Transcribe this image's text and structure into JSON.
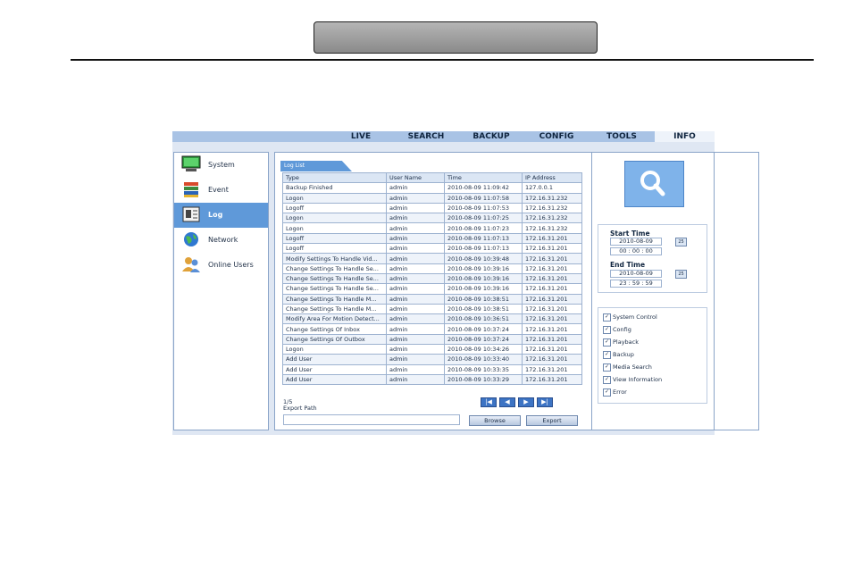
{
  "nav": [
    "LIVE",
    "SEARCH",
    "BACKUP",
    "CONFIG",
    "TOOLS",
    "INFO"
  ],
  "active_nav": "INFO",
  "sidebar": [
    {
      "label": "System",
      "icon": "system-icon"
    },
    {
      "label": "Event",
      "icon": "event-icon"
    },
    {
      "label": "Log",
      "icon": "log-icon"
    },
    {
      "label": "Network",
      "icon": "network-icon"
    },
    {
      "label": "Online Users",
      "icon": "online-users-icon"
    }
  ],
  "log": {
    "tab": "Log List",
    "columns": [
      "Type",
      "User Name",
      "Time",
      "IP Address"
    ],
    "rows": [
      [
        "Backup Finished",
        "admin",
        "2010-08-09 11:09:42",
        "127.0.0.1"
      ],
      [
        "Logon",
        "admin",
        "2010-08-09 11:07:58",
        "172.16.31.232"
      ],
      [
        "Logoff",
        "admin",
        "2010-08-09 11:07:53",
        "172.16.31.232"
      ],
      [
        "Logon",
        "admin",
        "2010-08-09 11:07:25",
        "172.16.31.232"
      ],
      [
        "Logon",
        "admin",
        "2010-08-09 11:07:23",
        "172.16.31.232"
      ],
      [
        "Logoff",
        "admin",
        "2010-08-09 11:07:13",
        "172.16.31.201"
      ],
      [
        "Logoff",
        "admin",
        "2010-08-09 11:07:13",
        "172.16.31.201"
      ],
      [
        "Modify Settings To Handle Vid...",
        "admin",
        "2010-08-09 10:39:48",
        "172.16.31.201"
      ],
      [
        "Change Settings To Handle Se...",
        "admin",
        "2010-08-09 10:39:16",
        "172.16.31.201"
      ],
      [
        "Change Settings To Handle Se...",
        "admin",
        "2010-08-09 10:39:16",
        "172.16.31.201"
      ],
      [
        "Change Settings To Handle Se...",
        "admin",
        "2010-08-09 10:39:16",
        "172.16.31.201"
      ],
      [
        "Change Settings To Handle M...",
        "admin",
        "2010-08-09 10:38:51",
        "172.16.31.201"
      ],
      [
        "Change Settings To Handle M...",
        "admin",
        "2010-08-09 10:38:51",
        "172.16.31.201"
      ],
      [
        "Modify Area For Motion Detect...",
        "admin",
        "2010-08-09 10:36:51",
        "172.16.31.201"
      ],
      [
        "Change Settings Of Inbox",
        "admin",
        "2010-08-09 10:37:24",
        "172.16.31.201"
      ],
      [
        "Change Settings Of Outbox",
        "admin",
        "2010-08-09 10:37:24",
        "172.16.31.201"
      ],
      [
        "Logon",
        "admin",
        "2010-08-09 10:34:26",
        "172.16.31.201"
      ],
      [
        "Add User",
        "admin",
        "2010-08-09 10:33:40",
        "172.16.31.201"
      ],
      [
        "Add User",
        "admin",
        "2010-08-09 10:33:35",
        "172.16.31.201"
      ],
      [
        "Add User",
        "admin",
        "2010-08-09 10:33:29",
        "172.16.31.201"
      ]
    ],
    "page": "1/5",
    "export_label": "Export Path",
    "browse": "Browse",
    "export": "Export",
    "pager": [
      "|◀",
      "◀",
      "▶",
      "▶|"
    ]
  },
  "time": {
    "start_label": "Start Time",
    "start_date": "2010-08-09",
    "start_time": "00 : 00 : 00",
    "end_label": "End Time",
    "end_date": "2010-08-09",
    "end_time": "23 : 59 : 59",
    "calendar": "25"
  },
  "filters": [
    "System Control",
    "Config",
    "Playback",
    "Backup",
    "Media Search",
    "View Information",
    "Error"
  ],
  "filter_checked": "✓",
  "colors": {
    "accent": "#5f99d9",
    "nav_bar": "#a9c3e5"
  }
}
